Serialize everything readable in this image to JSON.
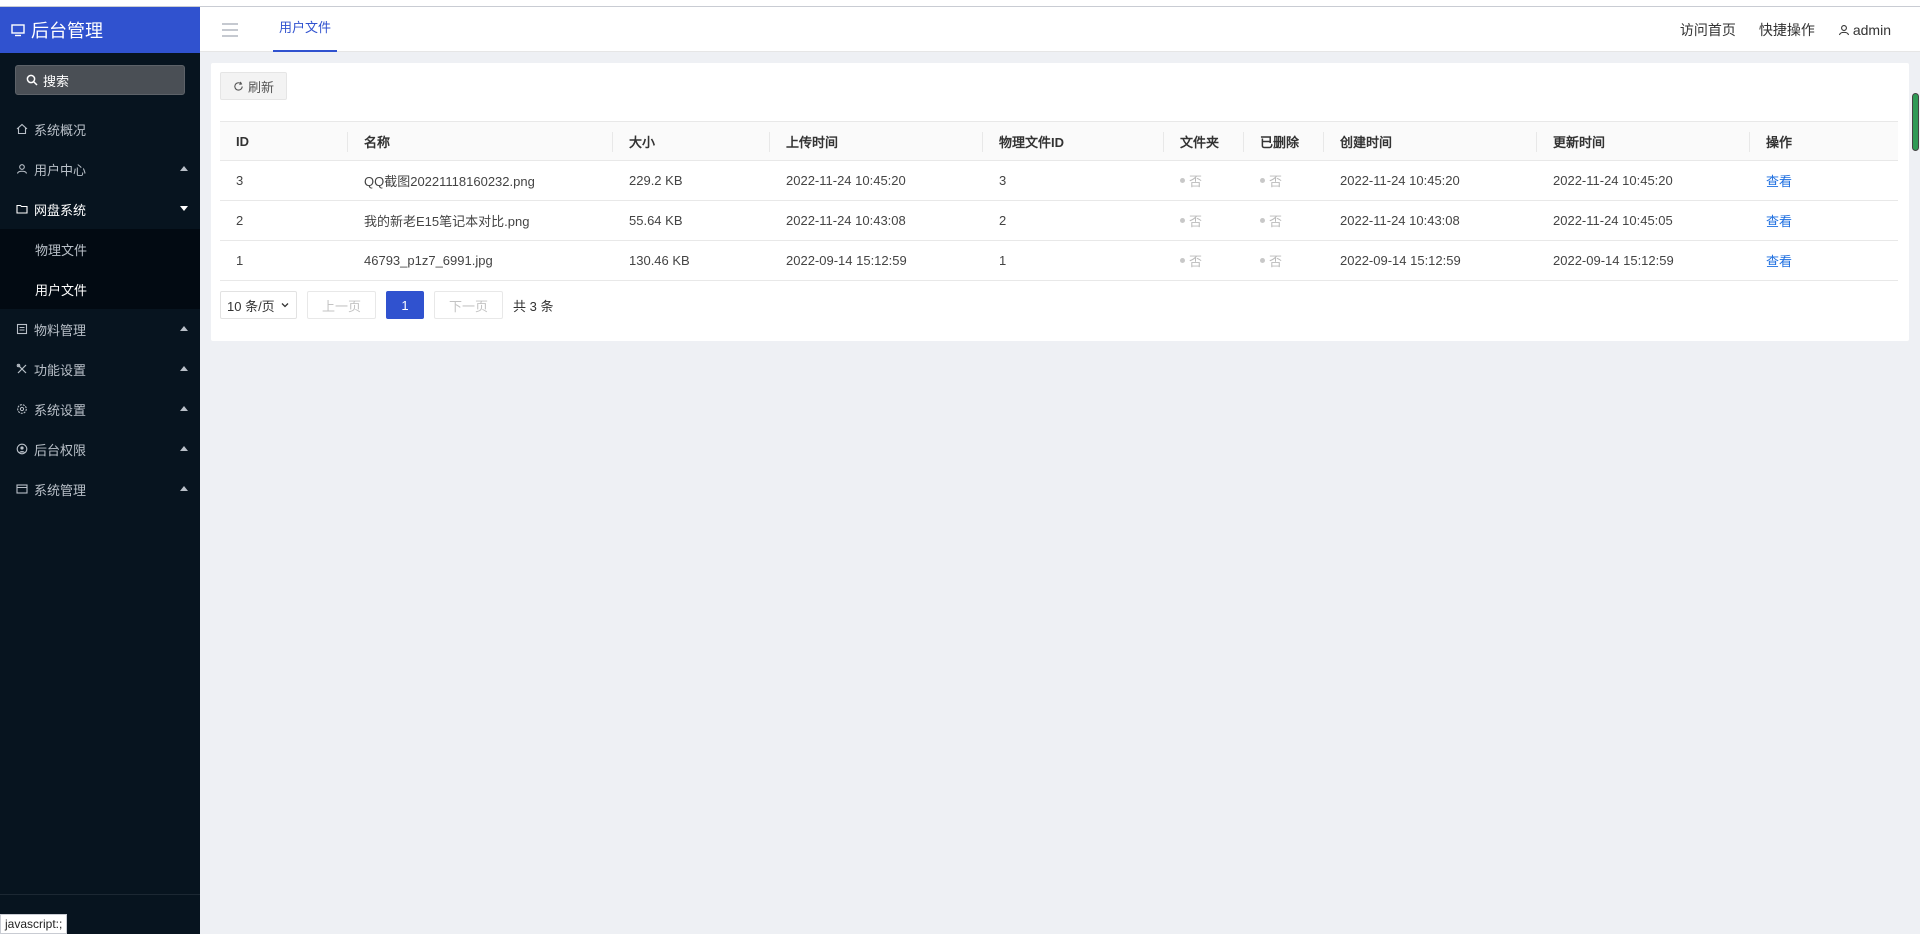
{
  "app": {
    "title": "后台管理",
    "search_placeholder": "搜索"
  },
  "sidebar": {
    "items": [
      {
        "label": "系统概况",
        "icon": "home-icon"
      },
      {
        "label": "用户中心",
        "icon": "users-icon"
      },
      {
        "label": "网盘系统",
        "icon": "folder-icon"
      },
      {
        "label": "物料管理",
        "icon": "list-icon"
      },
      {
        "label": "功能设置",
        "icon": "tools-icon"
      },
      {
        "label": "系统设置",
        "icon": "gear-icon"
      },
      {
        "label": "后台权限",
        "icon": "user-circle-icon"
      },
      {
        "label": "系统管理",
        "icon": "window-icon"
      }
    ],
    "sub_items": [
      {
        "label": "物理文件"
      },
      {
        "label": "用户文件"
      }
    ]
  },
  "header": {
    "active_tab": "用户文件",
    "visit_home": "访问首页",
    "quick_ops": "快捷操作",
    "user": "admin"
  },
  "toolbar": {
    "refresh_label": "刷新"
  },
  "table": {
    "columns": [
      "ID",
      "名称",
      "大小",
      "上传时间",
      "物理文件ID",
      "文件夹",
      "已删除",
      "创建时间",
      "更新时间",
      "操作"
    ],
    "rows": [
      {
        "id": "3",
        "name": "QQ截图20221118160232.png",
        "size": "229.2 KB",
        "upload_time": "2022-11-24 10:45:20",
        "physical_id": "3",
        "folder": "否",
        "deleted": "否",
        "created": "2022-11-24 10:45:20",
        "updated": "2022-11-24 10:45:20",
        "action": "查看"
      },
      {
        "id": "2",
        "name": "我的新老E15笔记本对比.png",
        "size": "55.64 KB",
        "upload_time": "2022-11-24 10:43:08",
        "physical_id": "2",
        "folder": "否",
        "deleted": "否",
        "created": "2022-11-24 10:43:08",
        "updated": "2022-11-24 10:45:05",
        "action": "查看"
      },
      {
        "id": "1",
        "name": "46793_p1z7_6991.jpg",
        "size": "130.46 KB",
        "upload_time": "2022-09-14 15:12:59",
        "physical_id": "1",
        "folder": "否",
        "deleted": "否",
        "created": "2022-09-14 15:12:59",
        "updated": "2022-09-14 15:12:59",
        "action": "查看"
      }
    ]
  },
  "pager": {
    "page_size": "10 条/页",
    "prev": "上一页",
    "current": "1",
    "next": "下一页",
    "total": "共 3 条"
  },
  "status_bar": {
    "url": "javascript:;"
  },
  "colors": {
    "brand": "#3052cf",
    "sidebar_bg": "#07141f",
    "link": "#1e6fe0"
  }
}
